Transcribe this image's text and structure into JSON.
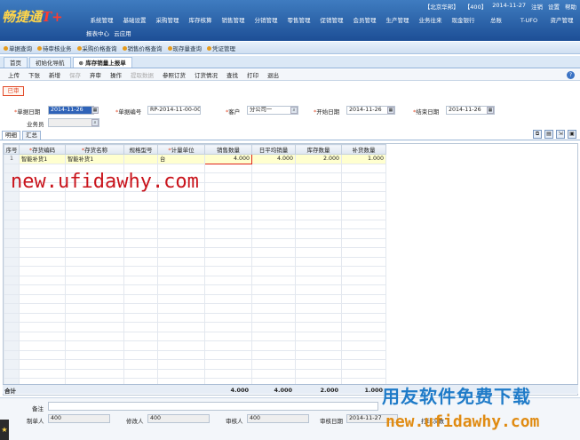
{
  "app": {
    "logo_main": "畅捷通",
    "logo_suffix": "T+"
  },
  "topinfo": {
    "account": "【北京华邦】",
    "user": "【400】",
    "date": "2014-11-27",
    "logout": "注销",
    "settings": "设置",
    "help": "帮助"
  },
  "main_menu": [
    "系统管理",
    "基础设置",
    "采购管理",
    "库存核算",
    "销售管理",
    "分销管理",
    "零售管理",
    "促销管理",
    "会员管理",
    "生产管理",
    "业务往来",
    "现金银行",
    "总账",
    "T-UFO",
    "资产管理"
  ],
  "sub_menu": [
    "报表中心",
    "云应用"
  ],
  "quickbar": [
    "单据查询",
    "待审核业务",
    "采购价格查询",
    "销售价格查询",
    "现存量查询",
    "凭证管理"
  ],
  "tabs": [
    {
      "label": "首页"
    },
    {
      "label": "初始化导航"
    },
    {
      "label": "库存销量上报单"
    }
  ],
  "toolbar": [
    "上传",
    "下张",
    "新增",
    "保存",
    "弃审",
    "操作",
    "提取数据",
    "参照订货",
    "订货情况",
    "查找",
    "打印",
    "退出"
  ],
  "status_label": "已审",
  "form": {
    "doc_date_label": "单据日期",
    "doc_date": "2014-11-26",
    "doc_no_label": "单据编号",
    "doc_no": "RP-2014-11-00-00...",
    "customer_label": "客户",
    "customer": "分公司一",
    "start_label": "开始日期",
    "start_date": "2014-11-26",
    "end_label": "结束日期",
    "end_date": "2014-11-26",
    "clerk_label": "业务员",
    "clerk": ""
  },
  "grid_tabs": [
    "明细",
    "汇总"
  ],
  "grid": {
    "columns": [
      "序号",
      "存货编码",
      "存货名称",
      "规格型号",
      "计量单位",
      "销售数量",
      "日平均销量",
      "库存数量",
      "补货数量"
    ],
    "rows": [
      [
        "1",
        "智能补货1",
        "智能补货1",
        "",
        "台",
        "4.000",
        "4.000",
        "2.000",
        "1.000"
      ]
    ],
    "totals": {
      "label": "合计",
      "sales": "4.000",
      "avg": "4.000",
      "stock": "2.000",
      "replenish": "1.000"
    }
  },
  "footer": {
    "remark_label": "备注",
    "remark": "",
    "maker_label": "制单人",
    "maker": "400",
    "modifier_label": "修改人",
    "modifier": "400",
    "auditor_label": "审核人",
    "auditor": "400",
    "audit_date_label": "审核日期",
    "audit_date": "2014-11-27",
    "print_label": "打印次数"
  },
  "watermarks": {
    "url_overlay": "new.ufidawhy.com",
    "brand": "用友软件免费下载",
    "brand_url": "new.ufidawhy.com"
  }
}
